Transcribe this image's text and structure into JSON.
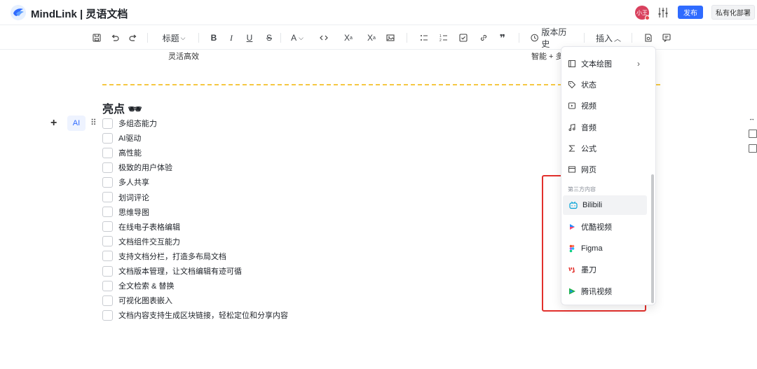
{
  "header": {
    "app_title": "MindLink | 灵语文档",
    "avatar_text": "小王",
    "publish_label": "发布",
    "private_label": "私有化部署"
  },
  "toolbar": {
    "heading_label": "标题",
    "font_color_label": "A",
    "superscript": "X",
    "subscript": "X",
    "version_history_label": "版本历史",
    "insert_label": "插入"
  },
  "content": {
    "cut_left": "灵活高效",
    "cut_right": "智能 + 多",
    "heading": "亮点 🕶",
    "ai_label": "AI",
    "tasks": [
      "多组态能力",
      "AI驱动",
      "高性能",
      "极致的用户体验",
      "多人共享",
      "划词评论",
      "思维导图",
      "在线电子表格编辑",
      "文档组件交互能力",
      "支持文档分栏，打造多布局文档",
      "文档版本管理，让文档编辑有迹可循",
      "全文检索 & 替换",
      "可视化图表嵌入",
      "文档内容支持生成区块链接，轻松定位和分享内容"
    ]
  },
  "insert_menu": {
    "items": [
      {
        "label": "文本绘图",
        "icon": "text-drawing-icon"
      },
      {
        "label": "状态",
        "icon": "tag-icon"
      },
      {
        "label": "视频",
        "icon": "video-icon"
      },
      {
        "label": "音频",
        "icon": "music-icon"
      },
      {
        "label": "公式",
        "icon": "sigma-icon"
      },
      {
        "label": "网页",
        "icon": "webpage-icon"
      }
    ],
    "section_label": "第三方内容",
    "third_party": [
      {
        "label": "Bilibili",
        "icon": "bilibili-icon",
        "color": "#00a1d6"
      },
      {
        "label": "优酷视频",
        "icon": "youku-icon",
        "color": "#1f8cff"
      },
      {
        "label": "Figma",
        "icon": "figma-icon",
        "color": "#f24e1e"
      },
      {
        "label": "墨刀",
        "icon": "modao-icon",
        "color": "#e2302c"
      },
      {
        "label": "腾讯视频",
        "icon": "tencent-video-icon",
        "color": "#20b24a"
      }
    ]
  },
  "colors": {
    "accent": "#2f6bff",
    "highlight_box": "#e2302c",
    "dashed_line": "#f5c842"
  }
}
